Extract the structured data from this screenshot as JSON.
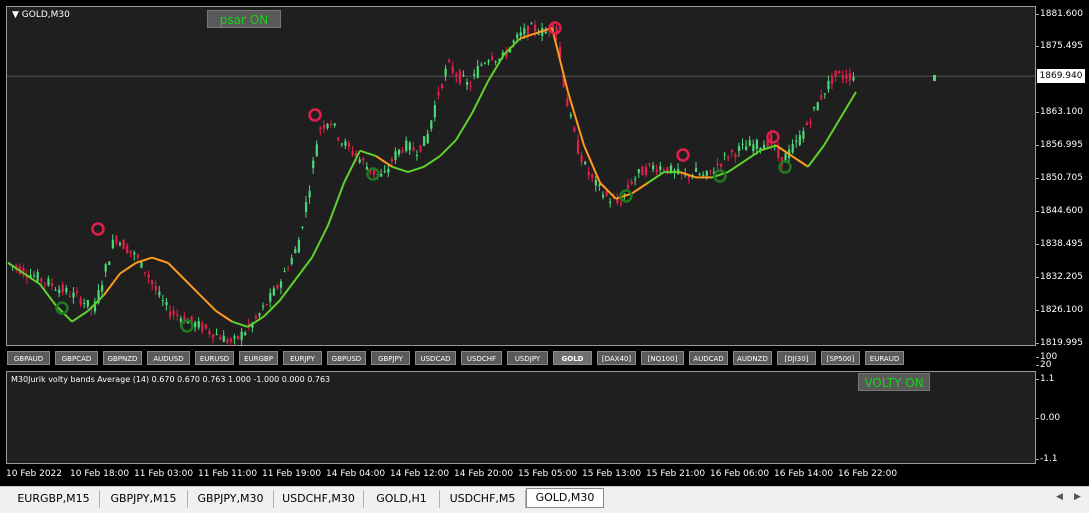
{
  "chart": {
    "title": "GOLD,M30",
    "psar_button": "psar ON",
    "current_price": "1869.940",
    "price_ticks": [
      "1881.600",
      "1875.495",
      "1869.940",
      "1863.100",
      "1856.995",
      "1850.705",
      "1844.600",
      "1838.495",
      "1832.205",
      "1826.100",
      "1819.995"
    ],
    "colors": {
      "bull": "#26a69a",
      "bull_bright": "#4cd97a",
      "bear": "#e0204a",
      "trend_up": "#5fd02c",
      "trend_down": "#ff9a1e"
    }
  },
  "symbols": [
    "GBPAUD",
    "GBPCAD",
    "GBPNZD",
    "AUDUSD",
    "EURUSD",
    "EURGBP",
    "EURJPY",
    "GBPUSD",
    "GBPJPY",
    "USDCAD",
    "USDCHF",
    "USDJPY",
    "GOLD",
    "[DAX40]",
    "[NQ100]",
    "AUDCAD",
    "AUDNZD",
    "[DJI30]",
    "[SP500]",
    "EURAUD"
  ],
  "active_symbol": "GOLD",
  "indicator": {
    "title": "M30Jurik volty bands Average (14) 0.670 0.670 0.763 1.000 -1.000 0.000 0.763",
    "volty_button": "VOLTY ON",
    "top_tick": "100",
    "ticks": [
      "1.1",
      "0.00",
      "-1.1"
    ],
    "upper_level": "20"
  },
  "time_labels": [
    "10 Feb 2022",
    "10 Feb 18:00",
    "11 Feb 03:00",
    "11 Feb 11:00",
    "11 Feb 19:00",
    "14 Feb 04:00",
    "14 Feb 12:00",
    "14 Feb 20:00",
    "15 Feb 05:00",
    "15 Feb 13:00",
    "15 Feb 21:00",
    "16 Feb 06:00",
    "16 Feb 14:00",
    "16 Feb 22:00"
  ],
  "tabs": [
    "EURGBP,M15",
    "GBPJPY,M15",
    "GBPJPY,M30",
    "USDCHF,M30",
    "GOLD,H1",
    "USDCHF,M5",
    "GOLD,M30"
  ],
  "active_tab": "GOLD,M30",
  "chart_data": {
    "type": "candlestick",
    "title": "GOLD,M30",
    "ylim": [
      1819.995,
      1881.6
    ],
    "close_path": [
      1835,
      1834,
      1833,
      1832,
      1831,
      1830,
      1829,
      1828,
      1826,
      1833,
      1840,
      1838,
      1836,
      1833,
      1829,
      1826,
      1825,
      1824,
      1823,
      1822,
      1821,
      1820,
      1822,
      1824,
      1827,
      1830,
      1834,
      1838,
      1848,
      1860,
      1862,
      1858,
      1856,
      1854,
      1852,
      1851,
      1855,
      1857,
      1856,
      1858,
      1866,
      1872,
      1870,
      1868,
      1872,
      1874,
      1873,
      1876,
      1878,
      1879,
      1878,
      1880,
      1866,
      1857,
      1852,
      1849,
      1847,
      1846,
      1850,
      1852,
      1853,
      1853,
      1852,
      1851,
      1852,
      1851,
      1853,
      1855,
      1856,
      1857,
      1857,
      1858,
      1854,
      1856,
      1859,
      1863,
      1867,
      1870,
      1870
    ],
    "trend_line": [
      1835,
      1833,
      1831,
      1827,
      1824,
      1826,
      1829,
      1833,
      1835,
      1836,
      1835,
      1832,
      1829,
      1826,
      1824,
      1823,
      1825,
      1828,
      1832,
      1836,
      1842,
      1850,
      1856,
      1855,
      1853,
      1852,
      1853,
      1855,
      1858,
      1863,
      1869,
      1874,
      1877,
      1878,
      1879,
      1867,
      1857,
      1850,
      1847,
      1848,
      1850,
      1852,
      1852,
      1851,
      1851,
      1852,
      1854,
      1856,
      1857,
      1855,
      1853,
      1857,
      1862,
      1867
    ]
  }
}
